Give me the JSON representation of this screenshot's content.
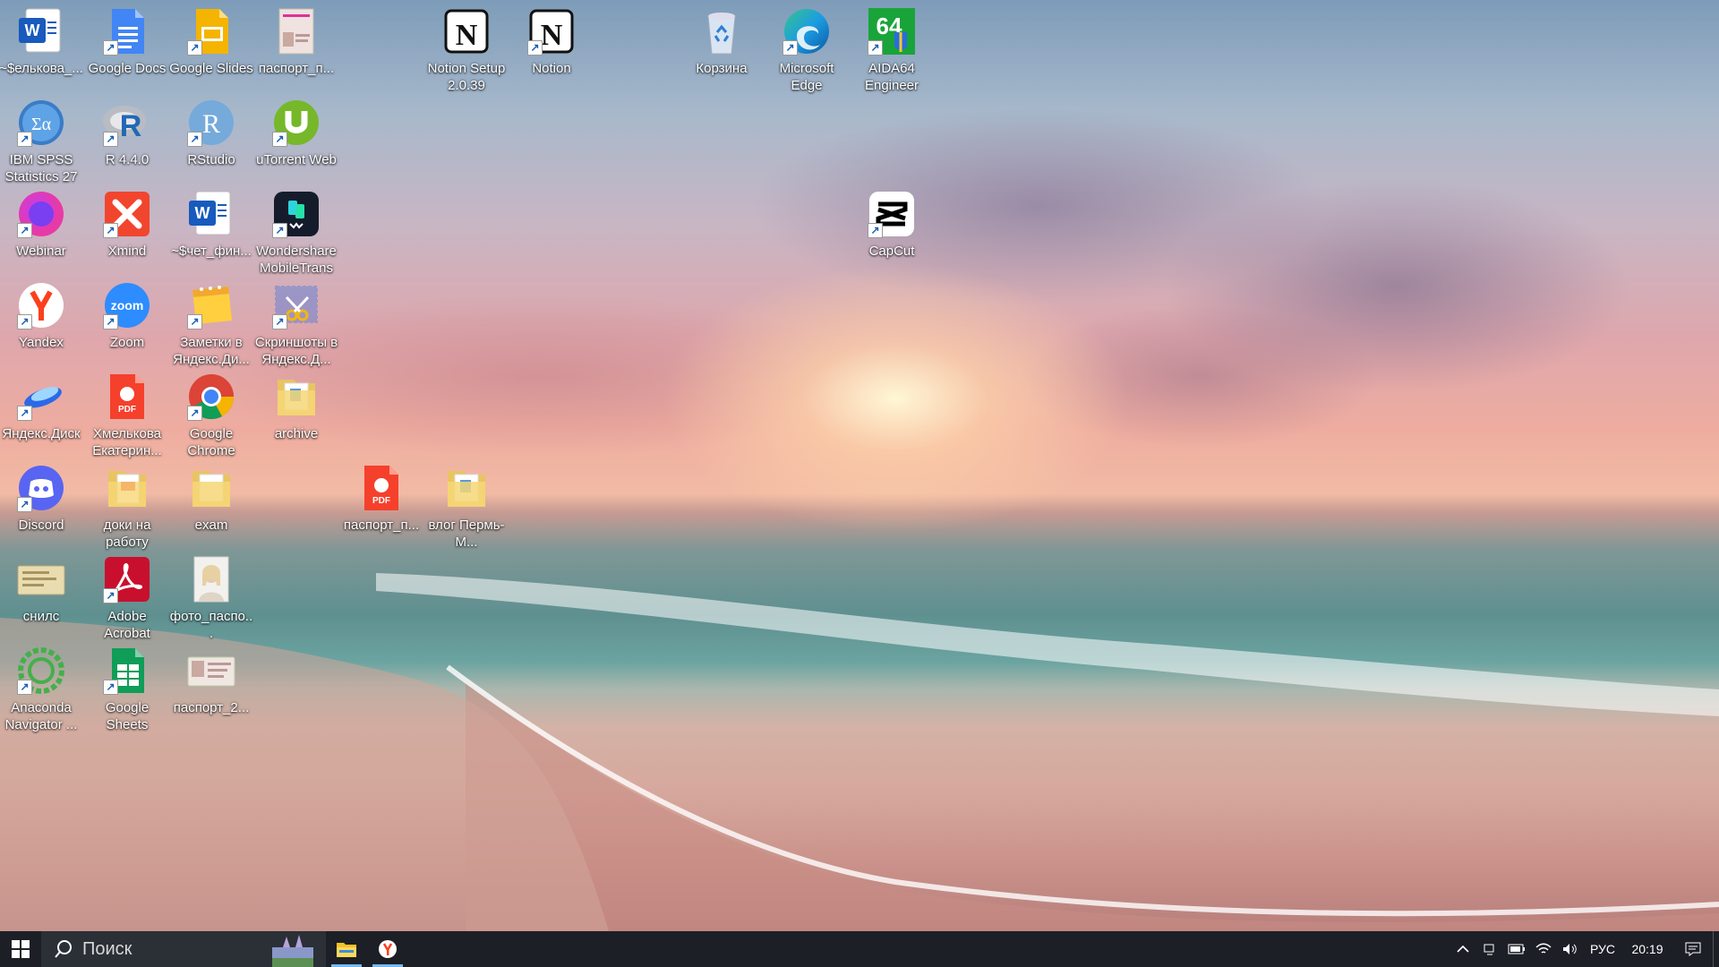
{
  "desktop": {
    "icons": [
      {
        "label": "~$елькова_...",
        "icon": "word-doc-icon"
      },
      {
        "label": "Google Docs",
        "icon": "google-docs-icon"
      },
      {
        "label": "Google Slides",
        "icon": "google-slides-icon"
      },
      {
        "label": "паспорт_п...",
        "icon": "passport-image-icon"
      },
      {
        "label": "Notion Setup 2.0.39",
        "icon": "notion-icon"
      },
      {
        "label": "Notion",
        "icon": "notion-icon"
      },
      {
        "label": "Корзина",
        "icon": "recycle-bin-icon"
      },
      {
        "label": "Microsoft Edge",
        "icon": "edge-icon"
      },
      {
        "label": "AIDA64 Engineer",
        "icon": "aida64-icon"
      },
      {
        "label": "IBM SPSS Statistics 27",
        "icon": "spss-icon"
      },
      {
        "label": "R 4.4.0",
        "icon": "r-icon"
      },
      {
        "label": "RStudio",
        "icon": "rstudio-icon"
      },
      {
        "label": "uTorrent Web",
        "icon": "utorrent-icon"
      },
      {
        "label": "Webinar",
        "icon": "webinar-icon"
      },
      {
        "label": "Xmind",
        "icon": "xmind-icon"
      },
      {
        "label": "~$чет_фин...",
        "icon": "word-doc-icon"
      },
      {
        "label": "Wondershare MobileTrans",
        "icon": "mobiletrans-icon"
      },
      {
        "label": "CapCut",
        "icon": "capcut-icon"
      },
      {
        "label": "Yandex",
        "icon": "yandex-browser-icon"
      },
      {
        "label": "Zoom",
        "icon": "zoom-icon"
      },
      {
        "label": "Заметки в Яндекс.Ди...",
        "icon": "yandex-notes-icon"
      },
      {
        "label": "Скриншоты в Яндекс.Д...",
        "icon": "yandex-screenshots-icon"
      },
      {
        "label": "Яндекс.Диск",
        "icon": "yandex-disk-icon"
      },
      {
        "label": "Хмелькова Екатерин...",
        "icon": "pdf-icon"
      },
      {
        "label": "Google Chrome",
        "icon": "chrome-icon"
      },
      {
        "label": "archive",
        "icon": "folder-icon"
      },
      {
        "label": "Discord",
        "icon": "discord-icon"
      },
      {
        "label": "доки на работу",
        "icon": "folder-pdf-icon"
      },
      {
        "label": "exam",
        "icon": "folder-icon"
      },
      {
        "label": "паспорт_п...",
        "icon": "pdf-icon"
      },
      {
        "label": "влог Пермь-М...",
        "icon": "folder-icon"
      },
      {
        "label": "снилс",
        "icon": "snils-image-icon"
      },
      {
        "label": "Adobe Acrobat",
        "icon": "acrobat-icon"
      },
      {
        "label": "фото_паспо...",
        "icon": "photo-icon"
      },
      {
        "label": "Anaconda Navigator ...",
        "icon": "anaconda-icon"
      },
      {
        "label": "Google Sheets",
        "icon": "google-sheets-icon"
      },
      {
        "label": "паспорт_2...",
        "icon": "passport-image-icon"
      }
    ]
  },
  "taskbar": {
    "search_placeholder": "Поиск",
    "apps": [
      "file-explorer-icon",
      "yandex-browser-icon"
    ],
    "tray": {
      "language": "РУС",
      "time": "20:19"
    }
  },
  "colors": {
    "taskbar_bg": "#1c1f26",
    "search_bg": "#2b2f36",
    "active_underline": "#76b9ed"
  }
}
